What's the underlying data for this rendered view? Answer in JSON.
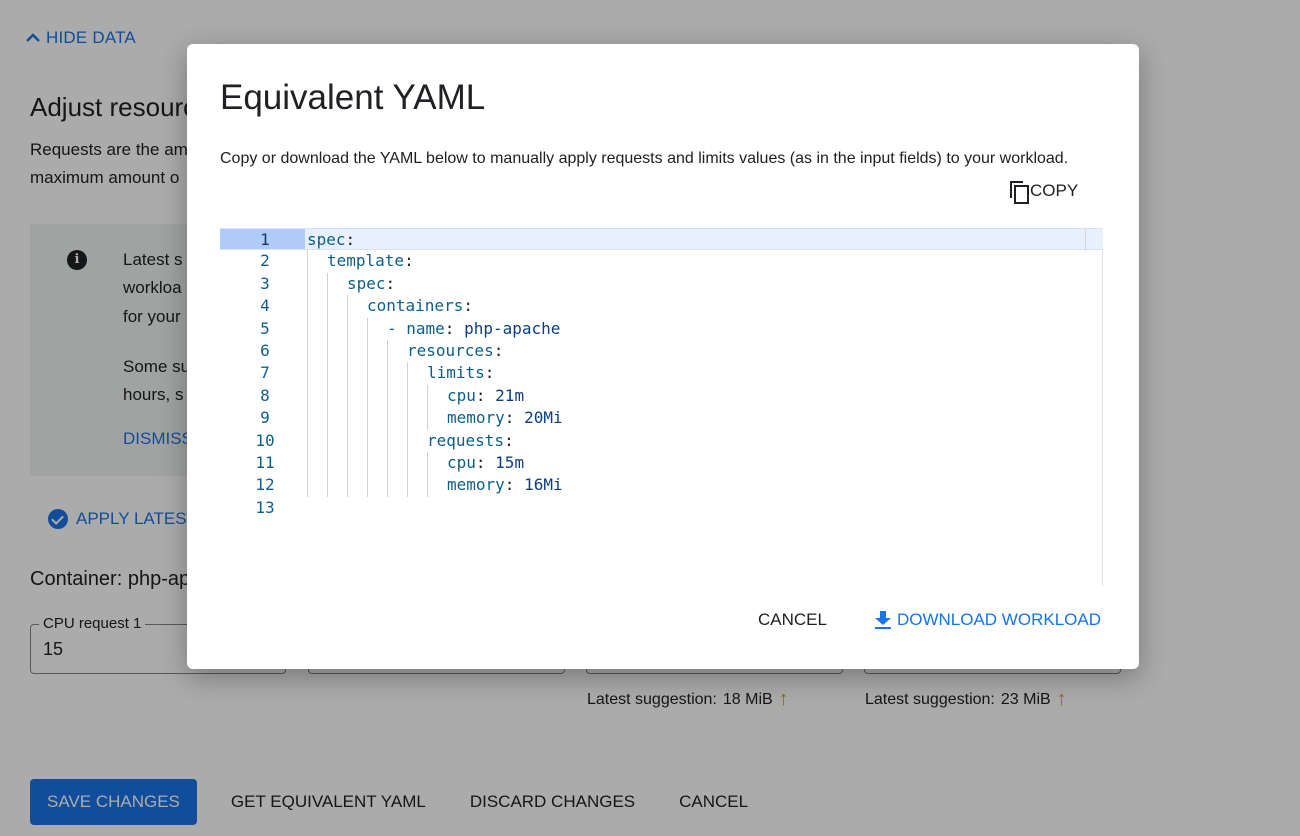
{
  "background": {
    "hide_data_label": "HIDE DATA",
    "adjust_title": "Adjust resourc",
    "requests_text_line1": "Requests are the am",
    "requests_text_line2": "maximum amount o",
    "info": {
      "line1": "Latest s",
      "line2": "workloa",
      "line3": "for your",
      "line4": "Some su",
      "line5": "hours, s",
      "dismiss": "DISMISS"
    },
    "apply_latest": "APPLY LATEST",
    "container_title": "Container: php-ap",
    "fields": [
      {
        "label": "CPU request 1",
        "value": "15"
      },
      {
        "label": "",
        "value": ""
      },
      {
        "label": "",
        "value": ""
      },
      {
        "label": "",
        "value": ""
      }
    ],
    "suggestions": [
      {
        "prefix": "Latest suggestion:",
        "value": "18 MiB"
      },
      {
        "prefix": "Latest suggestion:",
        "value": "23 MiB"
      }
    ],
    "bottom_actions": {
      "save": "SAVE CHANGES",
      "yaml": "GET EQUIVALENT YAML",
      "discard": "DISCARD CHANGES",
      "cancel": "CANCEL"
    }
  },
  "dialog": {
    "title": "Equivalent YAML",
    "description": "Copy or download the YAML below to manually apply requests and limits values (as in the input fields) to your workload.",
    "copy_label": "COPY",
    "cancel_label": "CANCEL",
    "download_label": "DOWNLOAD WORKLOAD",
    "yaml_lines": [
      {
        "num": "1",
        "indent": 0,
        "key": "spec",
        "value": ""
      },
      {
        "num": "2",
        "indent": 1,
        "key": "template",
        "value": ""
      },
      {
        "num": "3",
        "indent": 2,
        "key": "spec",
        "value": ""
      },
      {
        "num": "4",
        "indent": 3,
        "key": "containers",
        "value": ""
      },
      {
        "num": "5",
        "indent": 4,
        "key": "- name",
        "value": "php-apache"
      },
      {
        "num": "6",
        "indent": 5,
        "key": "resources",
        "value": ""
      },
      {
        "num": "7",
        "indent": 6,
        "key": "limits",
        "value": ""
      },
      {
        "num": "8",
        "indent": 7,
        "key": "cpu",
        "value": "21m"
      },
      {
        "num": "9",
        "indent": 7,
        "key": "memory",
        "value": "20Mi"
      },
      {
        "num": "10",
        "indent": 6,
        "key": "requests",
        "value": ""
      },
      {
        "num": "11",
        "indent": 7,
        "key": "cpu",
        "value": "15m"
      },
      {
        "num": "12",
        "indent": 7,
        "key": "memory",
        "value": "16Mi"
      },
      {
        "num": "13",
        "indent": 0,
        "key": "",
        "value": ""
      }
    ]
  }
}
